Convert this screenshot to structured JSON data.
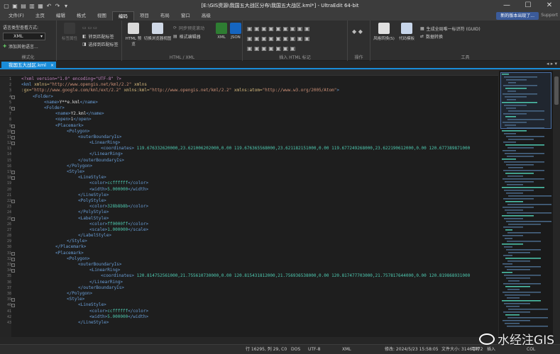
{
  "titlebar": {
    "title": "[E:\\GIS资源\\我国五大战区分布\\我国五大战区.kml*] - UltraEdit 64-bit",
    "controls": [
      "—",
      "☐",
      "✕"
    ]
  },
  "menu": {
    "tabs": [
      "文件(F)",
      "主页",
      "编辑",
      "格式",
      "视图",
      "编码",
      "项目",
      "布局",
      "窗口",
      "高级"
    ],
    "active_index": 5,
    "notice": "新的版本出现了...",
    "support": "Support"
  },
  "ribbon": {
    "mode_label": "语言类型查看方式:",
    "language_value": "XML",
    "add_language": "添加其他语言...",
    "groups": {
      "mode": "模式化",
      "html_xml": "HTML / XML",
      "insert_html": "插入 HTML 标记",
      "ops": "操作",
      "tools": "工具"
    },
    "buttons": {
      "attrs": "标签属性",
      "to_matching": "转到匹配标签",
      "select_matching": "选择到匹配标签",
      "html_preview": "HTML 预览",
      "toggle_browser": "切换浏览器视图",
      "sync_preview": "同步预览滚动",
      "format_editor": "格式编辑器",
      "xml": "XML",
      "json": "JSON",
      "style_convert": "风格转换(S)",
      "code_template": "代码模板",
      "gen_guid": "生成全局唯一标识符 (GUID)",
      "data_convert": "数据转换"
    }
  },
  "file_tab": {
    "name": "我国五大战区.kml"
  },
  "code_lines": [
    {
      "n": "1",
      "indent": 0,
      "parts": [
        [
          "pi",
          "<?xml version=\"1.0\" encoding=\"UTF-8\" ?>"
        ]
      ]
    },
    {
      "n": "2",
      "indent": 0,
      "parts": [
        [
          "tag",
          "<kml "
        ],
        [
          "attr",
          "xmlns="
        ],
        [
          "val",
          "\"http://www.opengis.net/kml/2.2\""
        ],
        [
          "attr",
          " xmlns"
        ]
      ]
    },
    {
      "n": "3",
      "indent": 0,
      "parts": [
        [
          "attr",
          ":gx="
        ],
        [
          "val",
          "\"http://www.google.com/kml/ext/2.2\""
        ],
        [
          "attr",
          " xmlns:kml="
        ],
        [
          "val",
          "\"http://www.opengis.net/kml/2.2\""
        ],
        [
          "attr",
          " xmlns:atom="
        ],
        [
          "val",
          "\"http://www.w3.org/2005/Atom\""
        ],
        [
          "tag",
          ">"
        ]
      ]
    },
    {
      "n": "4",
      "indent": 1,
      "parts": [
        [
          "tag",
          "<Folder>"
        ]
      ]
    },
    {
      "n": "5",
      "indent": 2,
      "parts": [
        [
          "tag",
          "<name>"
        ],
        [
          "txt",
          "Y**e.kml"
        ],
        [
          "tag",
          "</name>"
        ]
      ]
    },
    {
      "n": "6",
      "indent": 2,
      "parts": [
        [
          "tag",
          "<Folder>"
        ]
      ]
    },
    {
      "n": "7",
      "indent": 3,
      "parts": [
        [
          "tag",
          "<name>"
        ],
        [
          "txt",
          "Y2.kml"
        ],
        [
          "tag",
          "</name>"
        ]
      ]
    },
    {
      "n": "8",
      "indent": 3,
      "parts": [
        [
          "tag",
          "<open>"
        ],
        [
          "txt",
          "1"
        ],
        [
          "tag",
          "</open>"
        ]
      ]
    },
    {
      "n": "9",
      "indent": 3,
      "parts": [
        [
          "tag",
          "<Placemark>"
        ]
      ]
    },
    {
      "n": "10",
      "indent": 4,
      "parts": [
        [
          "tag",
          "<Polygon>"
        ]
      ]
    },
    {
      "n": "11",
      "indent": 5,
      "parts": [
        [
          "tag",
          "<outerBoundaryIs>"
        ]
      ]
    },
    {
      "n": "12",
      "indent": 6,
      "parts": [
        [
          "tag",
          "<LinearRing>"
        ]
      ]
    },
    {
      "n": "13",
      "indent": 7,
      "parts": [
        [
          "tag",
          "<coordinates>"
        ],
        [
          "num",
          " 119.676332620000,23.621006202000,0.00 119.676365568000,23.621182151000,0.00 119.677249268000,23.622190612000,0.00 120.677389871000"
        ]
      ]
    },
    {
      "n": "14",
      "indent": 6,
      "parts": [
        [
          "tag",
          "</LinearRing>"
        ]
      ]
    },
    {
      "n": "15",
      "indent": 5,
      "parts": [
        [
          "tag",
          "</outerBoundaryIs>"
        ]
      ]
    },
    {
      "n": "16",
      "indent": 4,
      "parts": [
        [
          "tag",
          "</Polygon>"
        ]
      ]
    },
    {
      "n": "17",
      "indent": 4,
      "parts": [
        [
          "tag",
          "<Style>"
        ]
      ]
    },
    {
      "n": "18",
      "indent": 5,
      "parts": [
        [
          "tag",
          "<LineStyle>"
        ]
      ]
    },
    {
      "n": "19",
      "indent": 6,
      "parts": [
        [
          "tag",
          "<color>"
        ],
        [
          "num",
          "ccffffff"
        ],
        [
          "tag",
          "</color>"
        ]
      ]
    },
    {
      "n": "20",
      "indent": 6,
      "parts": [
        [
          "tag",
          "<width>"
        ],
        [
          "num",
          "5.000000"
        ],
        [
          "tag",
          "</width>"
        ]
      ]
    },
    {
      "n": "21",
      "indent": 5,
      "parts": [
        [
          "tag",
          "</LineStyle>"
        ]
      ]
    },
    {
      "n": "22",
      "indent": 5,
      "parts": [
        [
          "tag",
          "<PolyStyle>"
        ]
      ]
    },
    {
      "n": "23",
      "indent": 6,
      "parts": [
        [
          "tag",
          "<color>"
        ],
        [
          "num",
          "328b8b8b"
        ],
        [
          "tag",
          "</color>"
        ]
      ]
    },
    {
      "n": "24",
      "indent": 5,
      "parts": [
        [
          "tag",
          "</PolyStyle>"
        ]
      ]
    },
    {
      "n": "25",
      "indent": 5,
      "parts": [
        [
          "tag",
          "<LabelStyle>"
        ]
      ]
    },
    {
      "n": "26",
      "indent": 6,
      "parts": [
        [
          "tag",
          "<color>"
        ],
        [
          "num",
          "ff0000ff"
        ],
        [
          "tag",
          "</color>"
        ]
      ]
    },
    {
      "n": "27",
      "indent": 6,
      "parts": [
        [
          "tag",
          "<scale>"
        ],
        [
          "num",
          "1.000000"
        ],
        [
          "tag",
          "</scale>"
        ]
      ]
    },
    {
      "n": "28",
      "indent": 5,
      "parts": [
        [
          "tag",
          "</LabelStyle>"
        ]
      ]
    },
    {
      "n": "29",
      "indent": 4,
      "parts": [
        [
          "tag",
          "</Style>"
        ]
      ]
    },
    {
      "n": "30",
      "indent": 3,
      "parts": [
        [
          "tag",
          "</Placemark>"
        ]
      ]
    },
    {
      "n": "31",
      "indent": 3,
      "parts": [
        [
          "tag",
          "<Placemark>"
        ]
      ]
    },
    {
      "n": "32",
      "indent": 4,
      "parts": [
        [
          "tag",
          "<Polygon>"
        ]
      ]
    },
    {
      "n": "33",
      "indent": 5,
      "parts": [
        [
          "tag",
          "<outerBoundaryIs>"
        ]
      ]
    },
    {
      "n": "34",
      "indent": 6,
      "parts": [
        [
          "tag",
          "<LinearRing>"
        ]
      ]
    },
    {
      "n": "35",
      "indent": 7,
      "parts": [
        [
          "tag",
          "<coordinates>"
        ],
        [
          "num",
          " 120.814752561000,21.755610730000,0.00 120.815431812000,21.756936538000,0.00 120.817477703000,21.757817644000,0.00 120.819868931000"
        ]
      ]
    },
    {
      "n": "36",
      "indent": 6,
      "parts": [
        [
          "tag",
          "</LinearRing>"
        ]
      ]
    },
    {
      "n": "37",
      "indent": 5,
      "parts": [
        [
          "tag",
          "</outerBoundaryIs>"
        ]
      ]
    },
    {
      "n": "38",
      "indent": 4,
      "parts": [
        [
          "tag",
          "</Polygon>"
        ]
      ]
    },
    {
      "n": "39",
      "indent": 4,
      "parts": [
        [
          "tag",
          "<Style>"
        ]
      ]
    },
    {
      "n": "40",
      "indent": 5,
      "parts": [
        [
          "tag",
          "<LineStyle>"
        ]
      ]
    },
    {
      "n": "41",
      "indent": 6,
      "parts": [
        [
          "tag",
          "<color>"
        ],
        [
          "num",
          "ccffffff"
        ],
        [
          "tag",
          "</color>"
        ]
      ]
    },
    {
      "n": "42",
      "indent": 6,
      "parts": [
        [
          "tag",
          "<width>"
        ],
        [
          "num",
          "5.000000"
        ],
        [
          "tag",
          "</width>"
        ]
      ]
    },
    {
      "n": "43",
      "indent": 5,
      "parts": [
        [
          "tag",
          "</LineStyle>"
        ]
      ]
    }
  ],
  "statusbar": {
    "position": "行 16295, 列 29, C0",
    "line_ending": "DOS",
    "encoding": "UTF-8",
    "syntax": "XML",
    "modified": "修改: 2024/5/23 15:58:05",
    "size": "文件大小: 31461872",
    "writable": "可写",
    "insert": "插入",
    "col": "COL"
  },
  "watermark": "水经注GIS",
  "colors": {
    "accent": "#1a8cd8",
    "tag": "#6a9fd8",
    "attr": "#d7ba7d",
    "value": "#ce9178",
    "number": "#4ec9b0"
  }
}
